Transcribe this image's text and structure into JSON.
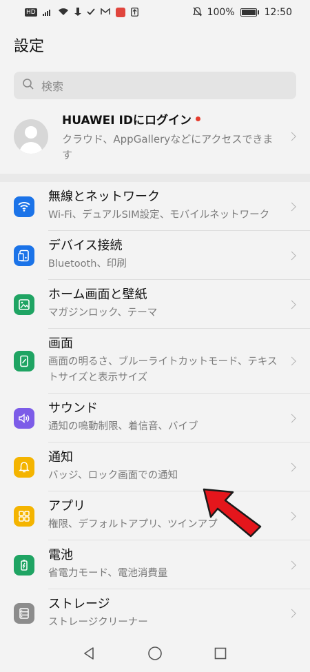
{
  "status": {
    "hd": "HD",
    "battery": "100%",
    "time": "12:50"
  },
  "title": "設定",
  "search": {
    "placeholder": "検索"
  },
  "account": {
    "title": "HUAWEI IDにログイン",
    "subtitle": "クラウド、AppGalleryなどにアクセスできます"
  },
  "items": [
    {
      "title": "無線とネットワーク",
      "subtitle": "Wi-Fi、デュアルSIM設定、モバイルネットワーク",
      "icon": "wifi-icon",
      "color": "#1b73e8"
    },
    {
      "title": "デバイス接続",
      "subtitle": "Bluetooth、印刷",
      "icon": "device-connection-icon",
      "color": "#1b73e8"
    },
    {
      "title": "ホーム画面と壁紙",
      "subtitle": "マガジンロック、テーマ",
      "icon": "wallpaper-icon",
      "color": "#1fa463"
    },
    {
      "title": "画面",
      "subtitle": "画面の明るさ、ブルーライトカットモード、テキストサイズと表示サイズ",
      "icon": "display-icon",
      "color": "#1fa463"
    },
    {
      "title": "サウンド",
      "subtitle": "通知の鳴動制限、着信音、バイブ",
      "icon": "speaker-icon",
      "color": "#7c5ce8"
    },
    {
      "title": "通知",
      "subtitle": "バッジ、ロック画面での通知",
      "icon": "bell-icon",
      "color": "#f4b400"
    },
    {
      "title": "アプリ",
      "subtitle": "権限、デフォルトアプリ、ツインアプ",
      "icon": "apps-grid-icon",
      "color": "#f4b400"
    },
    {
      "title": "電池",
      "subtitle": "省電力モード、電池消費量",
      "icon": "battery-icon",
      "color": "#1fa463"
    },
    {
      "title": "ストレージ",
      "subtitle": "ストレージクリーナー",
      "icon": "storage-icon",
      "color": "#8c8c8c"
    }
  ]
}
